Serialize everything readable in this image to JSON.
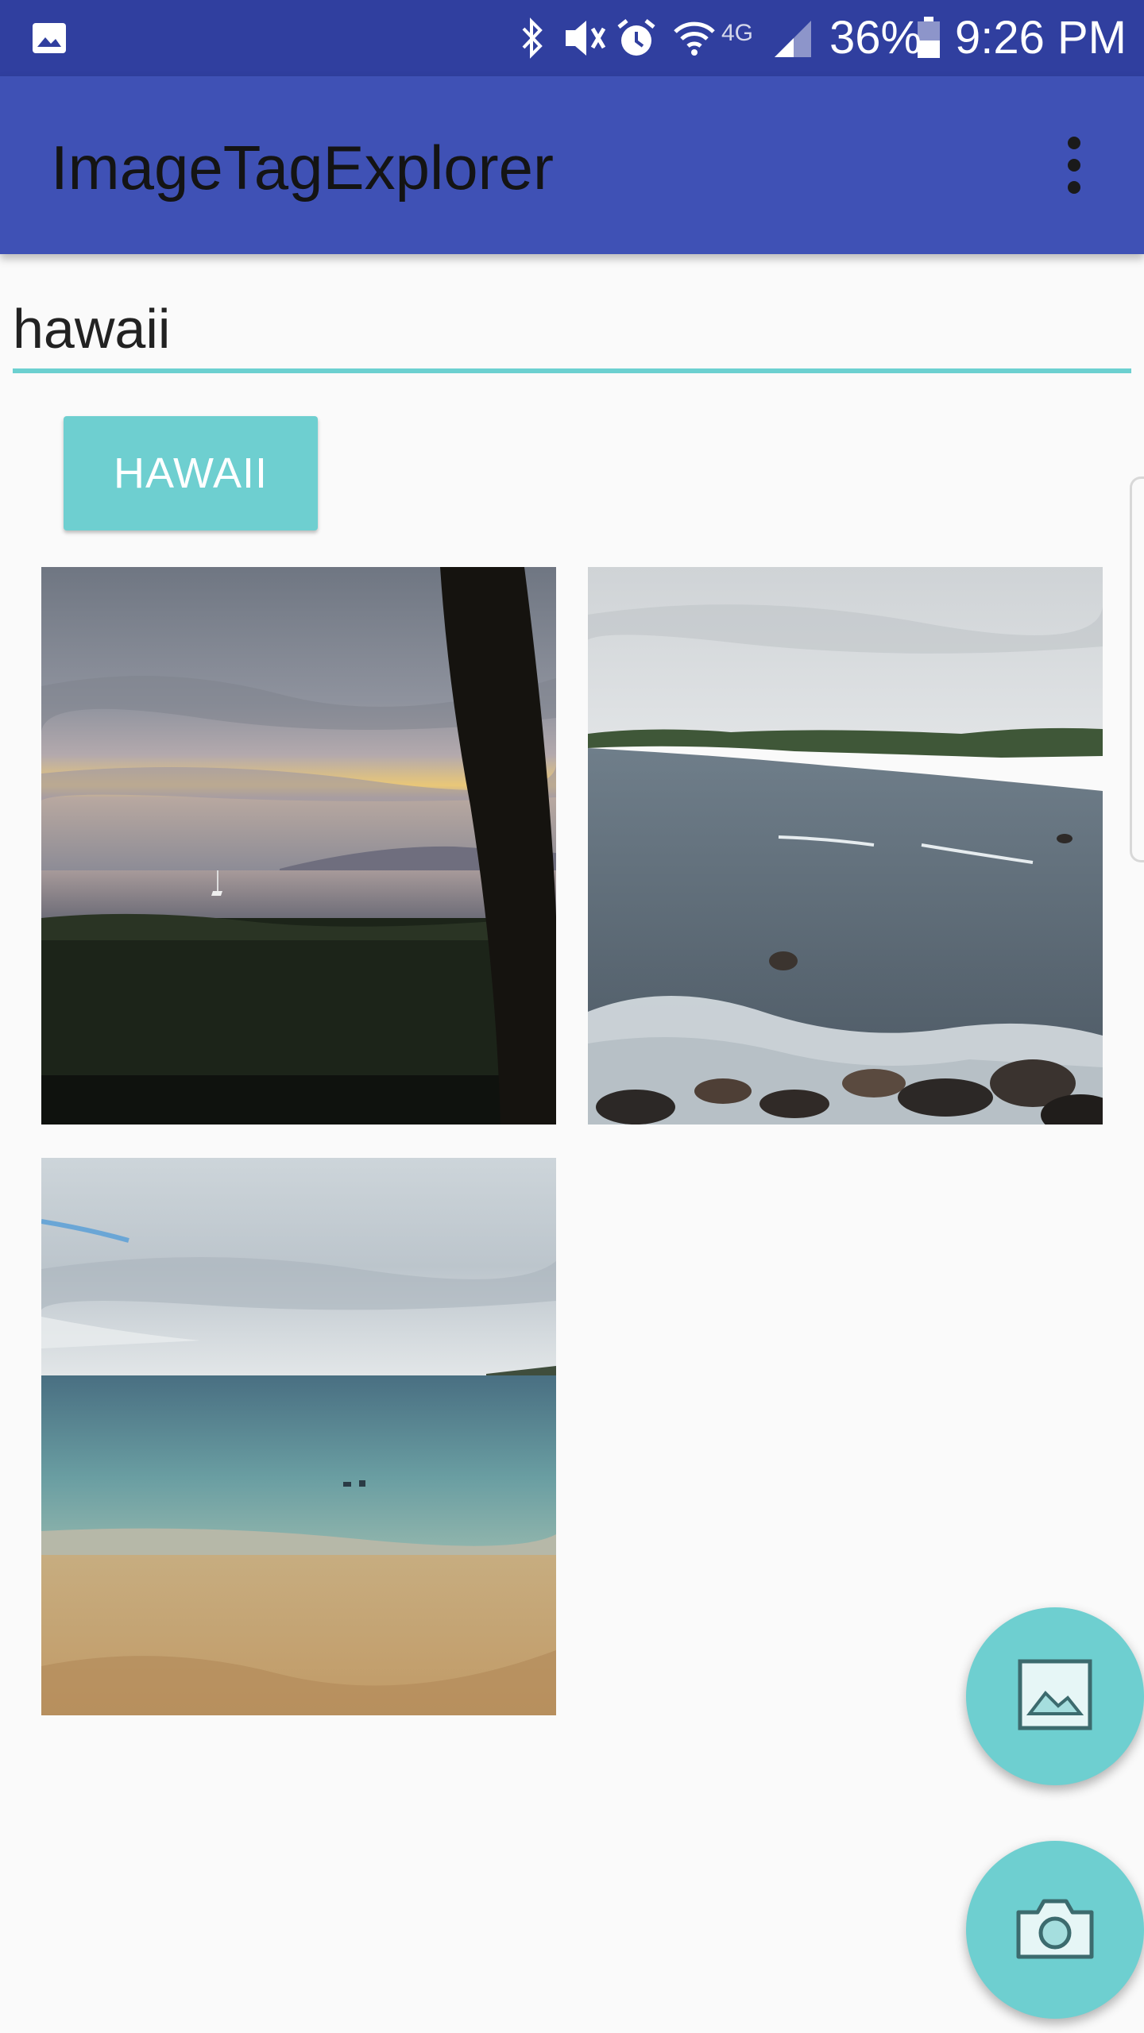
{
  "status_bar": {
    "battery_percent": "36%",
    "time": "9:26 PM",
    "network_label": "4G",
    "icons": [
      "gallery-notification-icon",
      "bluetooth-icon",
      "vibrate-icon",
      "alarm-icon",
      "wifi-icon",
      "signal-icon",
      "battery-icon"
    ]
  },
  "app_bar": {
    "title": "ImageTagExplorer",
    "menu_icon": "overflow-menu-icon"
  },
  "search": {
    "value": "hawaii"
  },
  "tags": [
    {
      "label": "HAWAII"
    }
  ],
  "photos": [
    {
      "subject": "sunset-palm-sailboat"
    },
    {
      "subject": "rocky-coastline"
    },
    {
      "subject": "sandy-beach-sea"
    }
  ],
  "fabs": {
    "gallery_icon": "image-gallery-icon",
    "camera_icon": "camera-icon"
  },
  "colors": {
    "status_bar": "#303f9f",
    "app_bar": "#3f51b5",
    "accent": "#6ecfd0",
    "background": "#fafafa"
  }
}
